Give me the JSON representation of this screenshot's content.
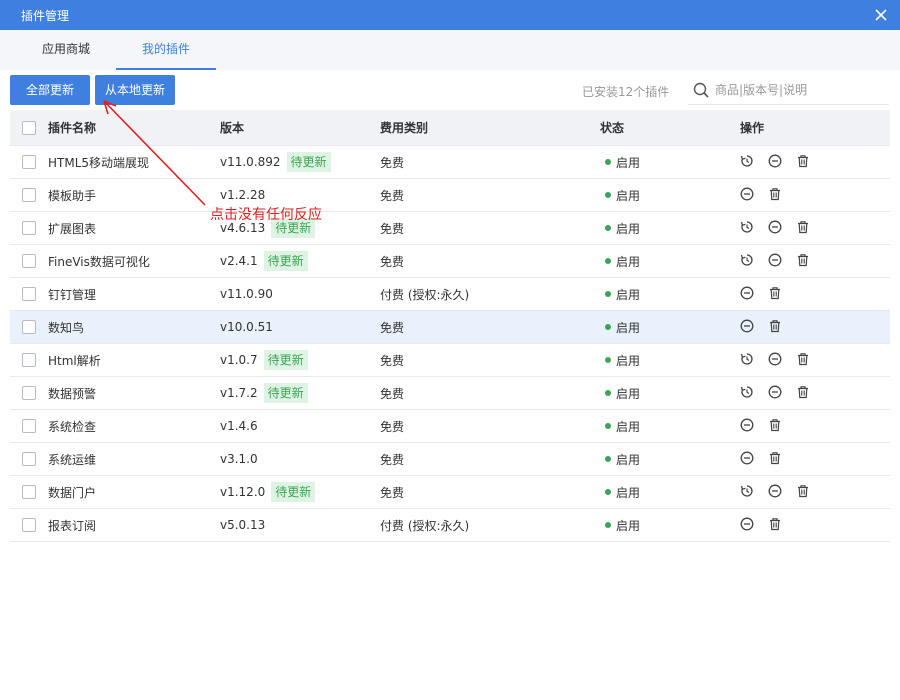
{
  "window": {
    "title": "插件管理"
  },
  "tabs": [
    {
      "label": "应用商城"
    },
    {
      "label": "我的插件"
    }
  ],
  "toolbar": {
    "update_all_label": "全部更新",
    "update_local_label": "从本地更新",
    "installed_count": "已安装12个插件",
    "search_placeholder": "商品|版本号|说明"
  },
  "table": {
    "headers": {
      "name": "插件名称",
      "version": "版本",
      "fee": "费用类别",
      "status": "状态",
      "actions": "操作"
    },
    "rows": [
      {
        "name": "HTML5移动端展现",
        "version": "v11.0.892",
        "update": "待更新",
        "fee": "免费",
        "status": "启用"
      },
      {
        "name": "模板助手",
        "version": "v1.2.28",
        "update": "",
        "fee": "免费",
        "status": "启用"
      },
      {
        "name": "扩展图表",
        "version": "v4.6.13",
        "update": "待更新",
        "fee": "免费",
        "status": "启用"
      },
      {
        "name": "FineVis数据可视化",
        "version": "v2.4.1",
        "update": "待更新",
        "fee": "免费",
        "status": "启用"
      },
      {
        "name": "钉钉管理",
        "version": "v11.0.90",
        "update": "",
        "fee": "付费 (授权:永久)",
        "status": "启用"
      },
      {
        "name": "数知鸟",
        "version": "v10.0.51",
        "update": "",
        "fee": "免费",
        "status": "启用"
      },
      {
        "name": "Html解析",
        "version": "v1.0.7",
        "update": "待更新",
        "fee": "免费",
        "status": "启用"
      },
      {
        "name": "数据预警",
        "version": "v1.7.2",
        "update": "待更新",
        "fee": "免费",
        "status": "启用"
      },
      {
        "name": "系统检查",
        "version": "v1.4.6",
        "update": "",
        "fee": "免费",
        "status": "启用"
      },
      {
        "name": "系统运维",
        "version": "v3.1.0",
        "update": "",
        "fee": "免费",
        "status": "启用"
      },
      {
        "name": "数据门户",
        "version": "v1.12.0",
        "update": "待更新",
        "fee": "免费",
        "status": "启用"
      },
      {
        "name": "报表订阅",
        "version": "v5.0.13",
        "update": "",
        "fee": "付费 (授权:永久)",
        "status": "启用"
      }
    ]
  },
  "annotation": {
    "text": "点击没有任何反应",
    "color": "#e02020"
  },
  "colors": {
    "accent": "#3f7fe0",
    "status_green": "#3aa552",
    "badge_bg": "#dff3e4"
  }
}
